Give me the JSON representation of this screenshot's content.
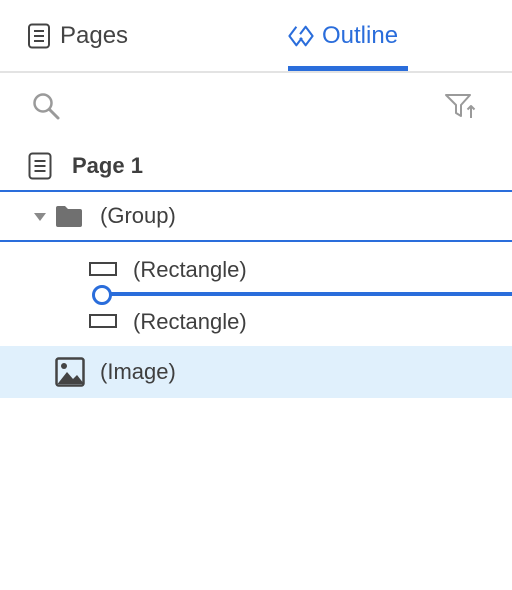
{
  "tabs": {
    "pages_label": "Pages",
    "outline_label": "Outline",
    "active": "Outline",
    "accent_color": "#2a6ddb"
  },
  "toolbar": {
    "search_icon": "search-icon",
    "filter_icon": "filter-sort-icon"
  },
  "outline": {
    "page": {
      "label": "Page 1",
      "icon": "page-icon"
    },
    "items": [
      {
        "label": "(Group)",
        "icon": "folder-icon",
        "expanded": true,
        "selected": true
      },
      {
        "label": "(Rectangle)",
        "icon": "rectangle-icon"
      },
      {
        "label": "(Rectangle)",
        "icon": "rectangle-icon"
      },
      {
        "label": "(Image)",
        "icon": "image-icon",
        "highlighted": true
      }
    ]
  },
  "colors": {
    "selection_border": "#2a6ddb",
    "highlight_background": "#e0f0fc"
  }
}
